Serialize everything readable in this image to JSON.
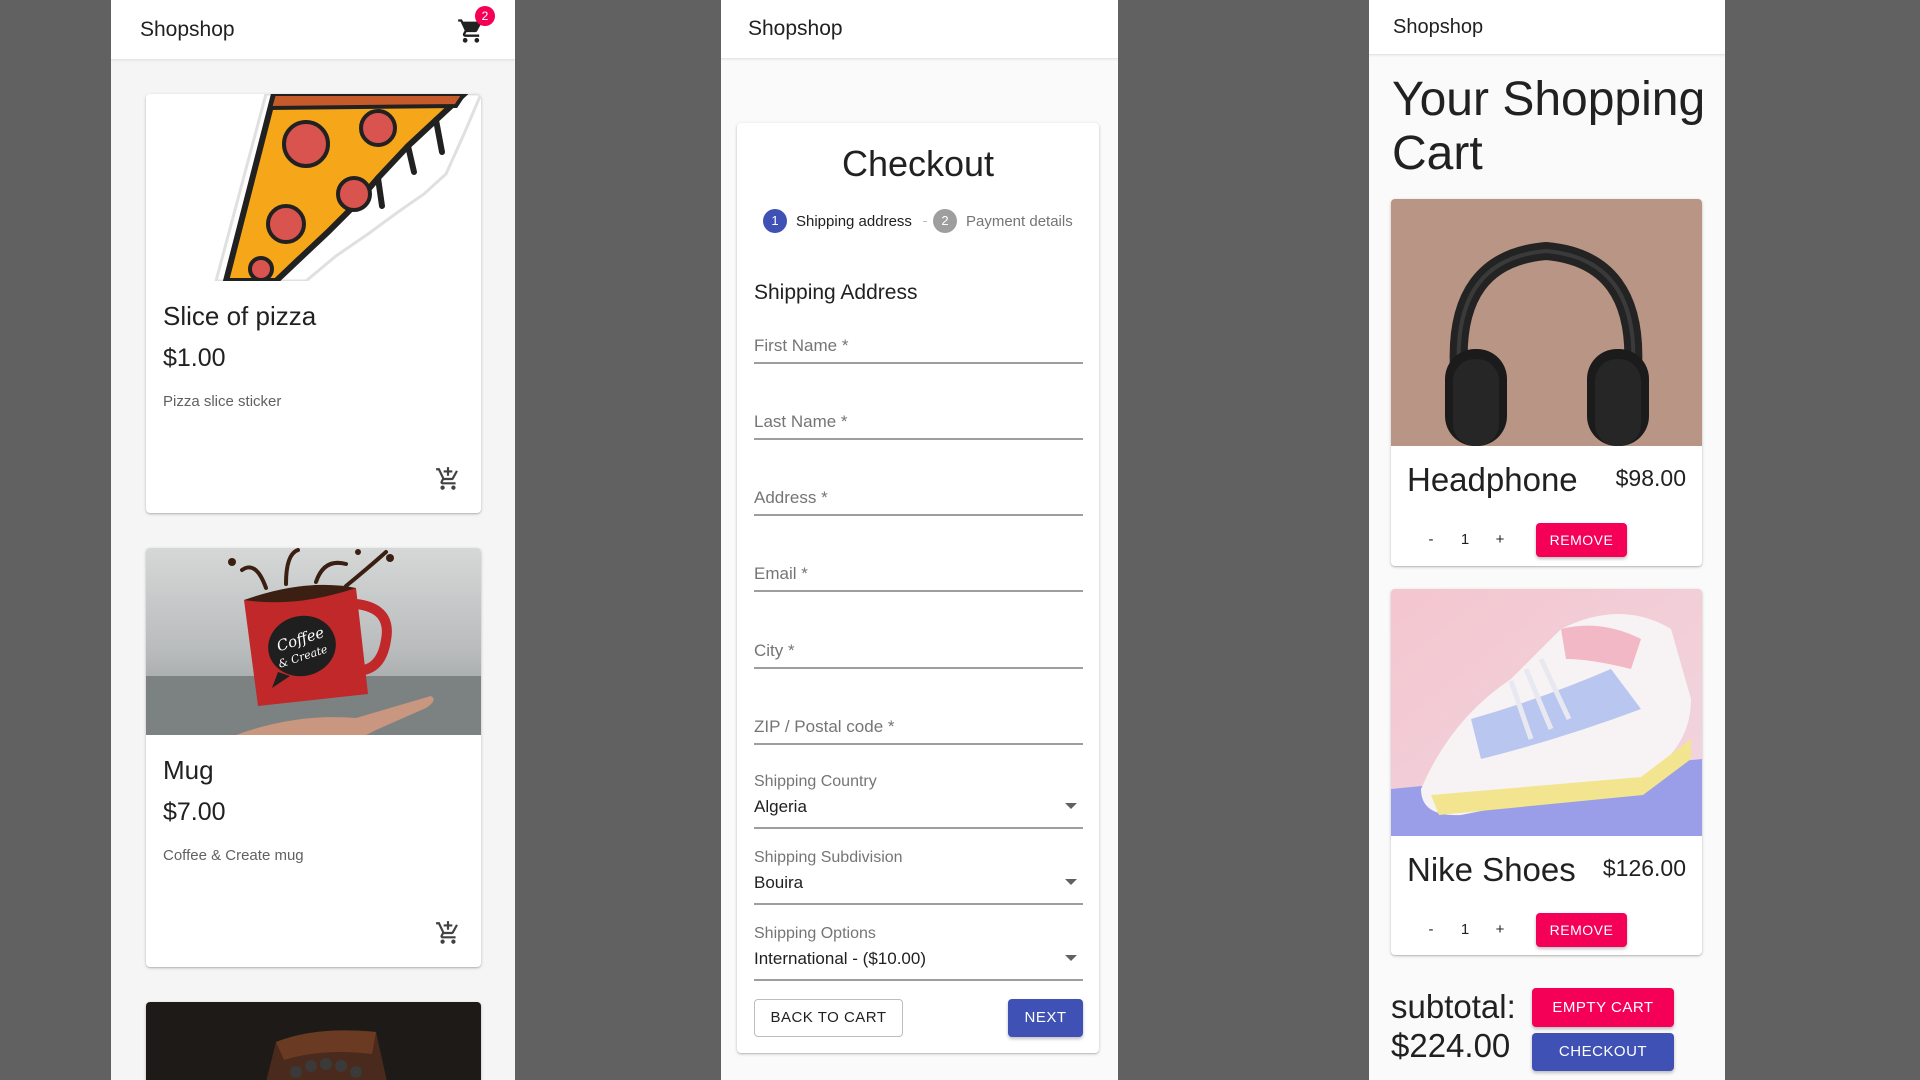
{
  "colors": {
    "primary": "#3f51b5",
    "secondary": "#f50057",
    "outer_bg": "#616161"
  },
  "products_view": {
    "brand": "Shopshop",
    "cart_badge": "2",
    "cart_icon": "shopping-cart-icon",
    "products": [
      {
        "name": "Slice of pizza",
        "price": "$1.00",
        "description": "Pizza slice sticker",
        "icon": "add-shopping-cart-icon"
      },
      {
        "name": "Mug",
        "price": "$7.00",
        "description": "Coffee & Create mug",
        "mug_text_1": "Coffee",
        "mug_text_2": "& Create",
        "icon": "add-shopping-cart-icon"
      }
    ]
  },
  "checkout_view": {
    "brand": "Shopshop",
    "title": "Checkout",
    "steps": [
      {
        "number": "1",
        "label": "Shipping address",
        "active": true
      },
      {
        "number": "2",
        "label": "Payment details",
        "active": false
      }
    ],
    "section_title": "Shipping Address",
    "fields": [
      {
        "label": "First Name *"
      },
      {
        "label": "Last Name *"
      },
      {
        "label": "Address *"
      },
      {
        "label": "Email *"
      },
      {
        "label": "City *"
      },
      {
        "label": "ZIP / Postal code *"
      }
    ],
    "selects": [
      {
        "label": "Shipping Country",
        "value": "Algeria"
      },
      {
        "label": "Shipping Subdivision",
        "value": "Bouira"
      },
      {
        "label": "Shipping Options",
        "value": "International - ($10.00)"
      }
    ],
    "back_label": "BACK TO CART",
    "next_label": "NEXT"
  },
  "cart_view": {
    "brand": "Shopshop",
    "title": "Your Shopping Cart",
    "items": [
      {
        "name": "Headphone",
        "price": "$98.00",
        "quantity": "1",
        "minus": "-",
        "plus": "+",
        "remove_label": "REMOVE"
      },
      {
        "name": "Nike Shoes",
        "price": "$126.00",
        "quantity": "1",
        "minus": "-",
        "plus": "+",
        "remove_label": "REMOVE"
      }
    ],
    "subtotal_label": "subtotal:",
    "subtotal_value": "$224.00",
    "empty_cart_label": "EMPTY CART",
    "checkout_label": "CHECKOUT"
  }
}
